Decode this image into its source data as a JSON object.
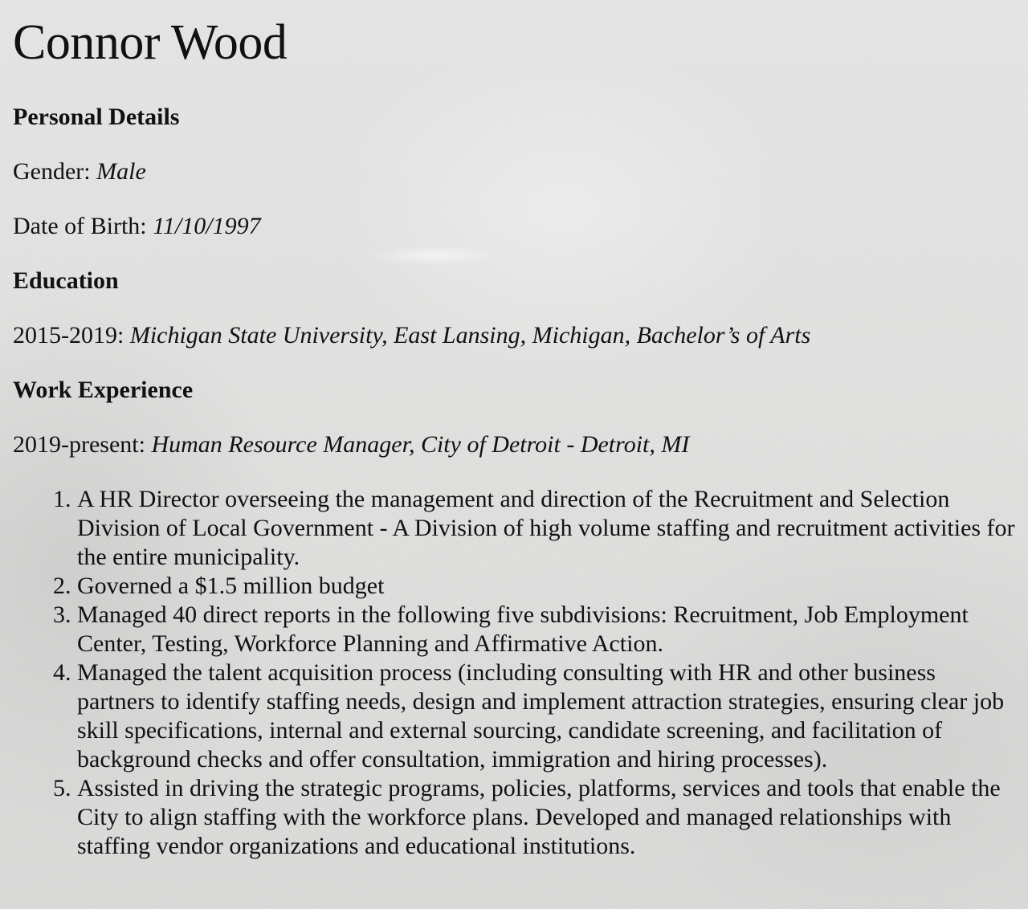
{
  "name": "Connor Wood",
  "personal_details": {
    "heading": "Personal Details",
    "gender_label": "Gender:",
    "gender_value": "Male",
    "dob_label": "Date of Birth:",
    "dob_value": "11/10/1997"
  },
  "education": {
    "heading": "Education",
    "entries": [
      {
        "period": "2015-2019:",
        "detail": "Michigan State University, East Lansing, Michigan, Bachelor’s of Arts"
      }
    ]
  },
  "work_experience": {
    "heading": "Work Experience",
    "jobs": [
      {
        "period": "2019-present:",
        "title": "Human Resource Manager, City of Detroit - Detroit, MI",
        "duties": [
          "A HR Director overseeing the management and direction of the Recruitment and Selection Division of Local Government - A Division of high volume staffing and recruitment activities for the entire municipality.",
          "Governed a $1.5 million budget",
          "Managed 40 direct reports in the following five subdivisions: Recruitment, Job Employment Center, Testing, Workforce Planning and Affirmative Action.",
          "Managed the talent acquisition process (including consulting with HR and other business partners to identify staffing needs, design and implement attraction strategies, ensuring clear job skill specifications, internal and external sourcing, candidate screening, and facilitation of background checks and offer consultation, immigration and hiring processes).",
          "Assisted in driving the strategic programs, policies, platforms, services and tools that enable the City to align staffing with the workforce plans. Developed and managed relationships with staffing vendor organizations and educational institutions."
        ]
      }
    ]
  }
}
